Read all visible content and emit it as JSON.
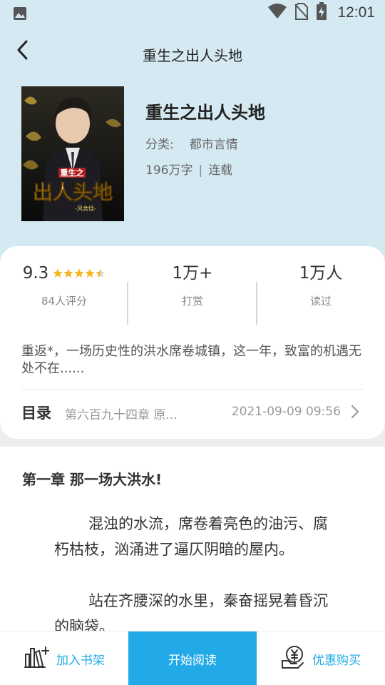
{
  "status_bar": {
    "time": "12:01",
    "icons": [
      "image-icon",
      "wifi-icon",
      "no-sim-icon",
      "battery-charging-icon"
    ]
  },
  "header": {
    "title": "重生之出人头地",
    "back_icon": "back-arrow-icon"
  },
  "book": {
    "title": "重生之出人头地",
    "category_label": "分类:",
    "category": "都市言情",
    "word_count": "196万字",
    "separator": "|",
    "status": "连载",
    "cover": {
      "title_small": "重生之",
      "title_big": "出人头地",
      "author": "-风舍恬-"
    }
  },
  "stats": {
    "rating": {
      "value": "9.3",
      "stars": 4.5,
      "label": "84人评分"
    },
    "tips": {
      "value": "1万+",
      "label": "打赏"
    },
    "readers": {
      "value": "1万人",
      "label": "读过"
    },
    "star_color": "#f5b51f"
  },
  "intro": "重返*，一场历史性的洪水席卷城镇，这一年，致富的机遇无处不在......",
  "toc": {
    "label": "目录",
    "latest_chapter": "第六百九十四章 原...",
    "date": "2021-09-09 09:56"
  },
  "preview": {
    "chapter_title": "第一章 那一场大洪水!",
    "paragraphs": [
      "混浊的水流，席卷着亮色的油污、腐朽枯枝，汹涌进了逼仄阴暗的屋内。",
      "站在齐腰深的水里，秦奋摇晃着昏沉的脑袋。"
    ]
  },
  "bottom_bar": {
    "add_shelf": "加入书架",
    "start_read": "开始阅读",
    "discount_buy": "优惠购买",
    "accent": "#22aae8"
  }
}
